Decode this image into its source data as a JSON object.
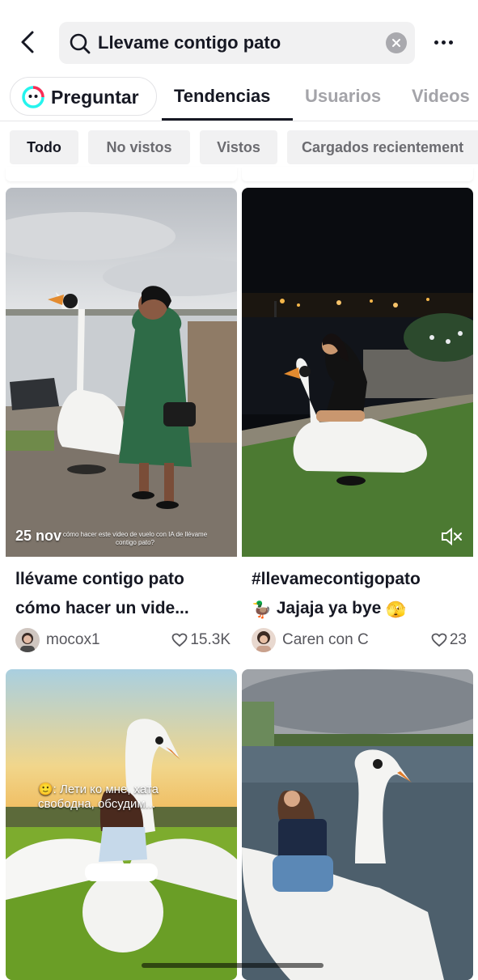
{
  "header": {
    "search_query": "Llevame contigo pato"
  },
  "tabs": {
    "ask_label": "Preguntar",
    "items": [
      "Tendencias",
      "Usuarios",
      "Videos"
    ],
    "active": "Tendencias"
  },
  "filters": {
    "items": [
      "Todo",
      "No vistos",
      "Vistos",
      "Cargados recientement"
    ],
    "active": "Todo"
  },
  "results": [
    {
      "title_line1": "llévame contigo pato",
      "title_line2": "cómo hacer un vide...",
      "author": "mocox1",
      "likes": "15.3K",
      "date": "25 nov",
      "caption": "cómo hacer este video de vuelo con IA de llévame contigo pato?"
    },
    {
      "title_line1": "#llevamecontigopato",
      "title_line2": "Jajaja ya bye",
      "title_emoji_start": "🦆",
      "title_emoji_end": "🫣",
      "author": "Caren con C",
      "likes": "23"
    },
    {
      "subtitle": "🙂: Лети ко мне, хата свободна, обсудим..."
    },
    {}
  ],
  "colors": {
    "accent": "#161823",
    "muted": "#a4a4a9",
    "chip_bg": "#f1f1f2"
  }
}
